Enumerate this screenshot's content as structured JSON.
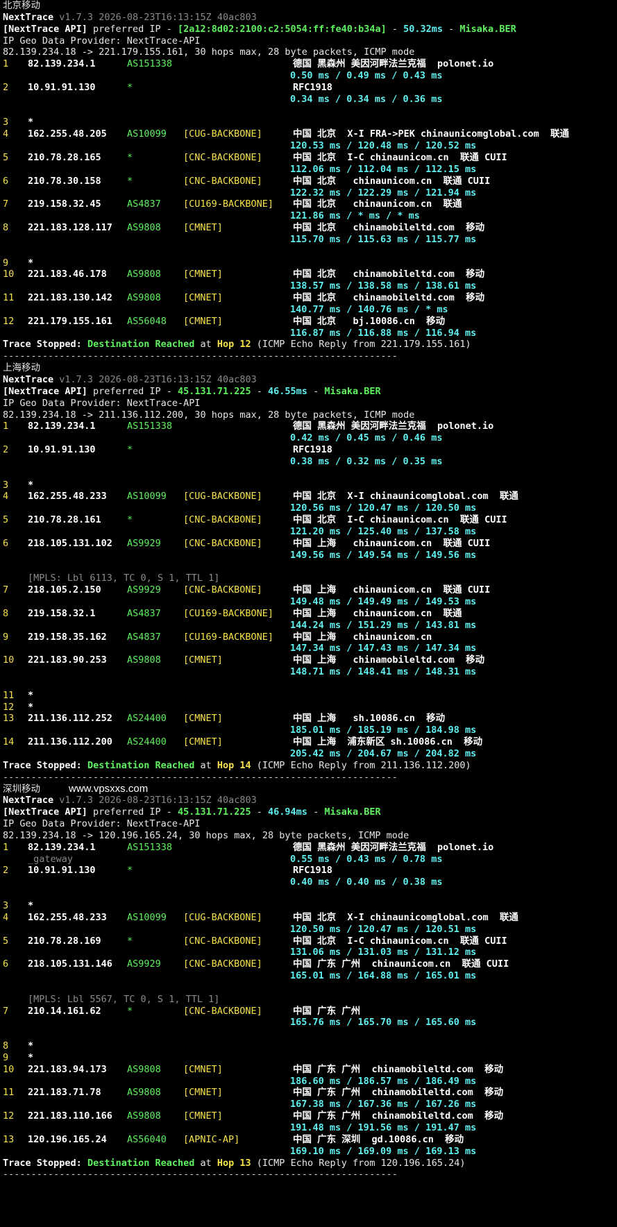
{
  "sections": [
    {
      "title": "北京移动",
      "version": "v1.7.3 2026-08-23T16:13:15Z 40ac803",
      "api_ip": "2a12:8d02:2100:c2:5054:ff:fe40:b34a",
      "api_ip_bracket": true,
      "latency": "50.32ms",
      "api_loc": "Misaka.BER",
      "provider": "IP Geo Data Provider: NextTrace-API",
      "route": "82.139.234.18 -> 221.179.155.161, 30 hops max, 28 byte packets, ICMP mode",
      "hops": [
        {
          "n": "1",
          "ip": "82.139.234.1",
          "as": "AS151338",
          "tag": "",
          "geo": "德国 黑森州 美因河畔法兰克福  polonet.io",
          "rtt": "0.50 ms / 0.49 ms / 0.43 ms"
        },
        {
          "n": "2",
          "ip": "10.91.91.130",
          "as": "*",
          "tag": "",
          "geo": "RFC1918",
          "rtt": "0.34 ms / 0.34 ms / 0.36 ms"
        },
        {
          "n": "3",
          "ip": "*"
        },
        {
          "n": "4",
          "ip": "162.255.48.205",
          "as": "AS10099",
          "tag": "[CUG-BACKBONE]",
          "geo": "中国 北京  X-I FRA->PEK chinaunicomglobal.com  联通",
          "rtt": "120.53 ms / 120.48 ms / 120.52 ms"
        },
        {
          "n": "5",
          "ip": "210.78.28.165",
          "as": "*",
          "tag": "[CNC-BACKBONE]",
          "geo": "中国 北京  I-C chinaunicom.cn  联通 CUII",
          "rtt": "112.06 ms / 112.04 ms / 112.15 ms"
        },
        {
          "n": "6",
          "ip": "210.78.30.158",
          "as": "*",
          "tag": "[CNC-BACKBONE]",
          "geo": "中国 北京   chinaunicom.cn  联通 CUII",
          "rtt": "122.32 ms / 122.29 ms / 121.94 ms"
        },
        {
          "n": "7",
          "ip": "219.158.32.45",
          "as": "AS4837",
          "tag": "[CU169-BACKBONE]",
          "geo": "中国 北京   chinaunicom.cn  联通",
          "rtt": "121.86 ms / * ms / * ms"
        },
        {
          "n": "8",
          "ip": "221.183.128.117",
          "as": "AS9808",
          "tag": "[CMNET]",
          "geo": "中国 北京   chinamobileltd.com  移动",
          "rtt": "115.70 ms / 115.63 ms / 115.77 ms"
        },
        {
          "n": "9",
          "ip": "*"
        },
        {
          "n": "10",
          "ip": "221.183.46.178",
          "as": "AS9808",
          "tag": "[CMNET]",
          "geo": "中国 北京   chinamobileltd.com  移动",
          "rtt": "138.57 ms / 138.58 ms / 138.61 ms"
        },
        {
          "n": "11",
          "ip": "221.183.130.142",
          "as": "AS9808",
          "tag": "[CMNET]",
          "geo": "中国 北京   chinamobileltd.com  移动",
          "rtt": "140.77 ms / 140.76 ms / * ms"
        },
        {
          "n": "12",
          "ip": "221.179.155.161",
          "as": "AS56048",
          "tag": "[CMNET]",
          "geo": "中国 北京   bj.10086.cn  移动",
          "rtt": "116.87 ms / 116.88 ms / 116.94 ms"
        }
      ],
      "stop_hop": "Hop 12",
      "stop_tail": " (ICMP Echo Reply from 221.179.155.161)"
    },
    {
      "title": "上海移动",
      "version": "v1.7.3 2026-08-23T16:13:15Z 40ac803",
      "api_ip": "45.131.71.225",
      "api_ip_bracket": false,
      "latency": "46.55ms",
      "api_loc": "Misaka.BER",
      "provider": "IP Geo Data Provider: NextTrace-API",
      "route": "82.139.234.18 -> 211.136.112.200, 30 hops max, 28 byte packets, ICMP mode",
      "hops": [
        {
          "n": "1",
          "ip": "82.139.234.1",
          "as": "AS151338",
          "tag": "",
          "geo": "德国 黑森州 美因河畔法兰克福  polonet.io",
          "rtt": "0.42 ms / 0.45 ms / 0.46 ms"
        },
        {
          "n": "2",
          "ip": "10.91.91.130",
          "as": "*",
          "tag": "",
          "geo": "RFC1918",
          "rtt": "0.38 ms / 0.32 ms / 0.35 ms"
        },
        {
          "n": "3",
          "ip": "*"
        },
        {
          "n": "4",
          "ip": "162.255.48.233",
          "as": "AS10099",
          "tag": "[CUG-BACKBONE]",
          "geo": "中国 北京  X-I chinaunicomglobal.com  联通",
          "rtt": "120.56 ms / 120.47 ms / 120.50 ms"
        },
        {
          "n": "5",
          "ip": "210.78.28.161",
          "as": "*",
          "tag": "[CNC-BACKBONE]",
          "geo": "中国 北京  I-C chinaunicom.cn  联通 CUII",
          "rtt": "121.20 ms / 125.40 ms / 137.58 ms"
        },
        {
          "n": "6",
          "ip": "218.105.131.102",
          "as": "AS9929",
          "tag": "[CNC-BACKBONE]",
          "geo": "中国 上海   chinaunicom.cn  联通 CUII",
          "rtt": "149.56 ms / 149.54 ms / 149.56 ms",
          "mpls": "[MPLS: Lbl 6113, TC 0, S 1, TTL 1]"
        },
        {
          "n": "7",
          "ip": "218.105.2.150",
          "as": "AS9929",
          "tag": "[CNC-BACKBONE]",
          "geo": "中国 上海   chinaunicom.cn  联通 CUII",
          "rtt": "149.48 ms / 149.49 ms / 149.53 ms"
        },
        {
          "n": "8",
          "ip": "219.158.32.1",
          "as": "AS4837",
          "tag": "[CU169-BACKBONE]",
          "geo": "中国 上海   chinaunicom.cn  联通",
          "rtt": "144.24 ms / 151.29 ms / 143.81 ms"
        },
        {
          "n": "9",
          "ip": "219.158.35.162",
          "as": "AS4837",
          "tag": "[CU169-BACKBONE]",
          "geo": "中国 上海   chinaunicom.cn",
          "rtt": "147.34 ms / 147.43 ms / 147.34 ms"
        },
        {
          "n": "10",
          "ip": "221.183.90.253",
          "as": "AS9808",
          "tag": "[CMNET]",
          "geo": "中国 上海   chinamobileltd.com  移动",
          "rtt": "148.71 ms / 148.41 ms / 148.31 ms"
        },
        {
          "n": "11",
          "ip": "*",
          "nogap": true
        },
        {
          "n": "12",
          "ip": "*"
        },
        {
          "n": "13",
          "ip": "211.136.112.252",
          "as": "AS24400",
          "tag": "[CMNET]",
          "geo": "中国 上海   sh.10086.cn  移动",
          "rtt": "185.01 ms / 185.19 ms / 184.98 ms"
        },
        {
          "n": "14",
          "ip": "211.136.112.200",
          "as": "AS24400",
          "tag": "[CMNET]",
          "geo": "中国 上海  浦东新区 sh.10086.cn  移动",
          "rtt": "205.42 ms / 204.67 ms / 204.82 ms"
        }
      ],
      "stop_hop": "Hop 14",
      "stop_tail": " (ICMP Echo Reply from 211.136.112.200)"
    },
    {
      "title": "深圳移动",
      "watermark": "www.vpsxxs.com",
      "version": "v1.7.3 2026-08-23T16:13:15Z 40ac803",
      "api_ip": "45.131.71.225",
      "api_ip_bracket": false,
      "latency": "46.94ms",
      "api_loc": "Misaka.BER",
      "provider": "IP Geo Data Provider: NextTrace-API",
      "route": "82.139.234.18 -> 120.196.165.24, 30 hops max, 28 byte packets, ICMP mode",
      "hops": [
        {
          "n": "1",
          "ip": "82.139.234.1",
          "as": "AS151338",
          "tag": "",
          "geo": "德国 黑森州 美因河畔法兰克福  polonet.io",
          "rtt": "0.55 ms / 0.43 ms / 0.78 ms",
          "sub": "_gateway"
        },
        {
          "n": "2",
          "ip": "10.91.91.130",
          "as": "*",
          "tag": "",
          "geo": "RFC1918",
          "rtt": "0.40 ms / 0.40 ms / 0.38 ms"
        },
        {
          "n": "3",
          "ip": "*"
        },
        {
          "n": "4",
          "ip": "162.255.48.233",
          "as": "AS10099",
          "tag": "[CUG-BACKBONE]",
          "geo": "中国 北京  X-I chinaunicomglobal.com  联通",
          "rtt": "120.50 ms / 120.47 ms / 120.51 ms"
        },
        {
          "n": "5",
          "ip": "210.78.28.169",
          "as": "*",
          "tag": "[CNC-BACKBONE]",
          "geo": "中国 北京  I-C chinaunicom.cn  联通 CUII",
          "rtt": "131.06 ms / 131.03 ms / 131.12 ms"
        },
        {
          "n": "6",
          "ip": "218.105.131.146",
          "as": "AS9929",
          "tag": "[CNC-BACKBONE]",
          "geo": "中国 广东 广州  chinaunicom.cn  联通 CUII",
          "rtt": "165.01 ms / 164.88 ms / 165.01 ms",
          "mpls": "[MPLS: Lbl 5567, TC 0, S 1, TTL 1]"
        },
        {
          "n": "7",
          "ip": "210.14.161.62",
          "as": "*",
          "tag": "[CNC-BACKBONE]",
          "geo": "中国 广东 广州",
          "rtt": "165.76 ms / 165.70 ms / 165.60 ms"
        },
        {
          "n": "8",
          "ip": "*",
          "nogap": true
        },
        {
          "n": "9",
          "ip": "*"
        },
        {
          "n": "10",
          "ip": "221.183.94.173",
          "as": "AS9808",
          "tag": "[CMNET]",
          "geo": "中国 广东 广州  chinamobileltd.com  移动",
          "rtt": "186.60 ms / 186.57 ms / 186.49 ms"
        },
        {
          "n": "11",
          "ip": "221.183.71.78",
          "as": "AS9808",
          "tag": "[CMNET]",
          "geo": "中国 广东 广州  chinamobileltd.com  移动",
          "rtt": "167.38 ms / 167.36 ms / 167.26 ms"
        },
        {
          "n": "12",
          "ip": "221.183.110.166",
          "as": "AS9808",
          "tag": "[CMNET]",
          "geo": "中国 广东 广州  chinamobileltd.com  移动",
          "rtt": "191.48 ms / 191.56 ms / 191.47 ms"
        },
        {
          "n": "13",
          "ip": "120.196.165.24",
          "as": "AS56040",
          "tag": "[APNIC-AP]",
          "geo": "中国 广东 深圳  gd.10086.cn  移动",
          "rtt": "169.10 ms / 169.09 ms / 169.13 ms"
        }
      ],
      "stop_hop": "Hop 13",
      "stop_tail": " (ICMP Echo Reply from 120.196.165.24)"
    }
  ],
  "labels": {
    "app": "NextTrace",
    "api_prefix": "[NextTrace API]",
    "api_mid": " preferred IP - ",
    "dash": " - ",
    "stop_prefix": "Trace Stopped:",
    "stop_mid": "Destination Reached",
    "stop_at": " at ",
    "separator": "----------------------------------------------------------------------"
  },
  "colors": {
    "green": "#5ff05f",
    "yellow": "#f5e14a",
    "cyan": "#5ff0f0",
    "gray": "#8a8a8a"
  }
}
